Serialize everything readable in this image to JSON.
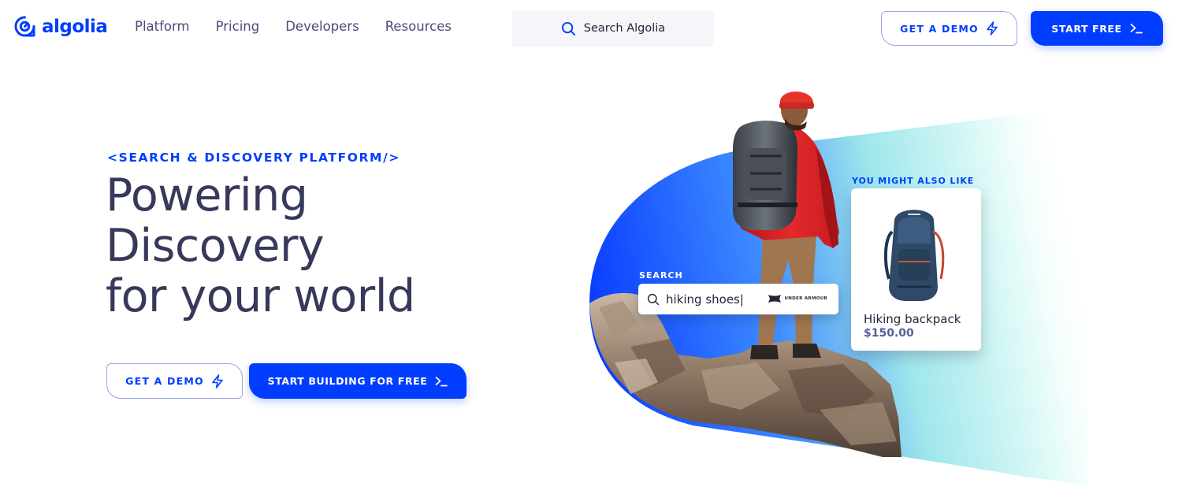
{
  "brand": {
    "name": "algolia",
    "color": "#003dff"
  },
  "nav": {
    "links": [
      "Platform",
      "Pricing",
      "Developers",
      "Resources"
    ],
    "search": {
      "placeholder": "Search Algolia",
      "icon": "search-icon"
    },
    "demo_label": "GET A DEMO",
    "free_label": "START FREE",
    "demo_icon": "lightning-icon",
    "free_icon": "terminal-prompt-icon"
  },
  "hero": {
    "eyebrow": "<SEARCH & DISCOVERY PLATFORM/>",
    "headline": [
      "Powering",
      "Discovery",
      "for your world"
    ],
    "demo_label": "GET A DEMO",
    "cta_label": "START BUILDING FOR FREE"
  },
  "visual": {
    "search_label": "SEARCH",
    "search_query": "hiking shoes|",
    "search_brand": "UNDER ARMOUR",
    "reco_label": "YOU MIGHT ALSO LIKE",
    "product": {
      "name": "Hiking backpack",
      "price": "$150.00"
    }
  },
  "colors": {
    "primary": "#003dff",
    "heading": "#36395a",
    "nav_text": "#484c7a",
    "gradient_blue": "#0a4dff",
    "gradient_mint": "#d9fbf6"
  }
}
